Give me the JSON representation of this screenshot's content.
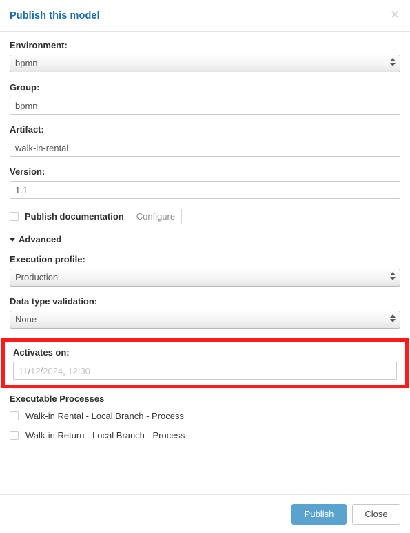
{
  "dialog": {
    "title": "Publish this model",
    "close_icon": "close-icon"
  },
  "form": {
    "environment": {
      "label": "Environment:",
      "value": "bpmn",
      "control": "select"
    },
    "group": {
      "label": "Group:",
      "value": "bpmn",
      "control": "text"
    },
    "artifact": {
      "label": "Artifact:",
      "value": "walk-in-rental",
      "control": "text"
    },
    "version": {
      "label": "Version:",
      "value": "1.1",
      "control": "text"
    },
    "publish_documentation": {
      "label": "Publish documentation",
      "checked": false,
      "configure_label": "Configure"
    },
    "advanced": {
      "label": "Advanced",
      "expanded": true,
      "caret_icon": "caret-down-icon"
    },
    "execution_profile": {
      "label": "Execution profile:",
      "value": "Production",
      "control": "select"
    },
    "data_type_validation": {
      "label": "Data type validation:",
      "value": "None",
      "control": "select"
    },
    "activates_on": {
      "label": "Activates on:",
      "placeholder_day": "11",
      "placeholder_sep1": "/",
      "placeholder_month": "12",
      "placeholder_sep2": "/",
      "placeholder_year": "2024",
      "placeholder_sep3": ", ",
      "placeholder_hour": "12",
      "placeholder_sep4": ":",
      "placeholder_minute": "30",
      "placeholder_full": "11/12/2024, 12:30",
      "highlight_color": "#fc1a1a"
    }
  },
  "executable_processes": {
    "title": "Executable Processes",
    "items": [
      {
        "label": "Walk-in Rental - Local Branch - Process",
        "checked": false
      },
      {
        "label": "Walk-in Return - Local Branch - Process",
        "checked": false
      }
    ]
  },
  "footer": {
    "publish_label": "Publish",
    "close_label": "Close"
  },
  "colors": {
    "title_blue": "#1a6ca8",
    "primary_button": "#5ba3cf",
    "highlight_red": "#fc1a1a"
  }
}
